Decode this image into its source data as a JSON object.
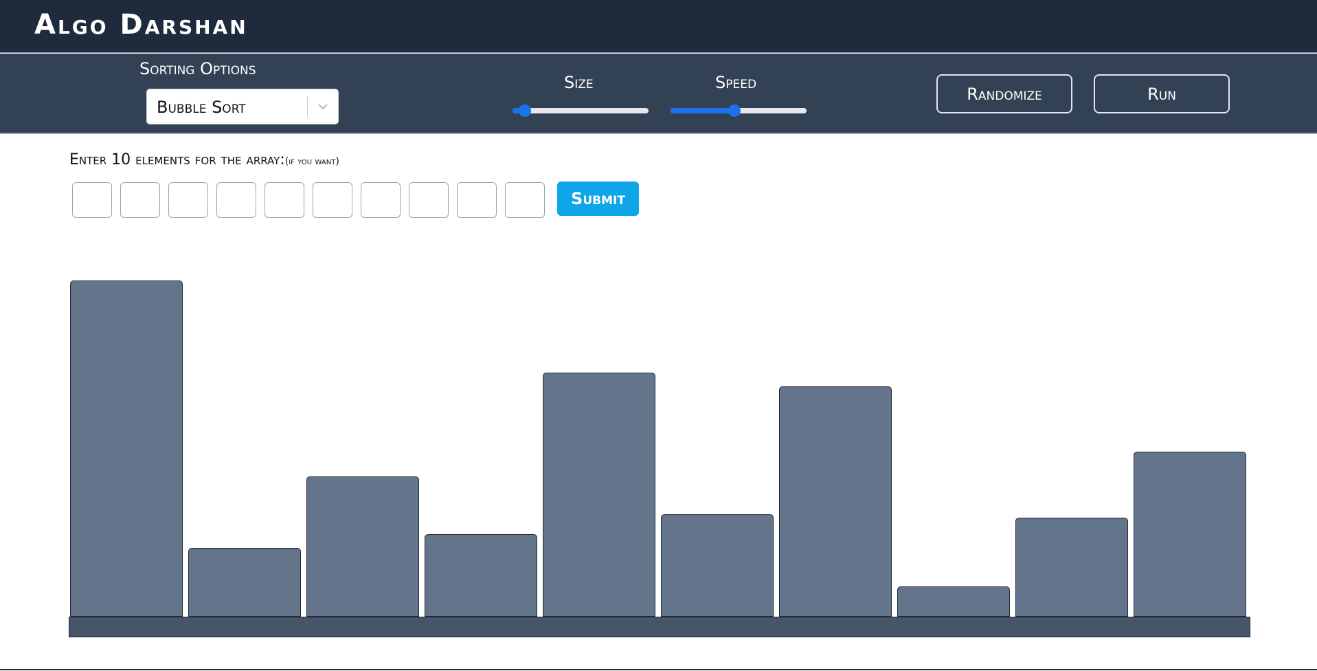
{
  "header": {
    "title": "Algo Darshan"
  },
  "controls": {
    "sorting_label": "Sorting Options",
    "sorting_selected": "Bubble Sort",
    "size_label": "Size",
    "size_level": 0.09,
    "speed_label": "Speed",
    "speed_level": 0.47,
    "randomize_label": "Randomize",
    "run_label": "Run",
    "accent_color": "#1a73e8"
  },
  "input": {
    "prompt": "Enter 10 elements for the array:",
    "hint": "(if you want)",
    "cells": [
      "",
      "",
      "",
      "",
      "",
      "",
      "",
      "",
      "",
      ""
    ],
    "submit_label": "Submit",
    "submit_color": "#0ea5e9"
  },
  "chart_data": {
    "type": "bar",
    "values": [
      100,
      20.5,
      41.8,
      24.5,
      72.5,
      30.5,
      68.5,
      9,
      29.5,
      49
    ],
    "ylim": [
      0,
      100
    ],
    "bar_color": "#64748b"
  }
}
